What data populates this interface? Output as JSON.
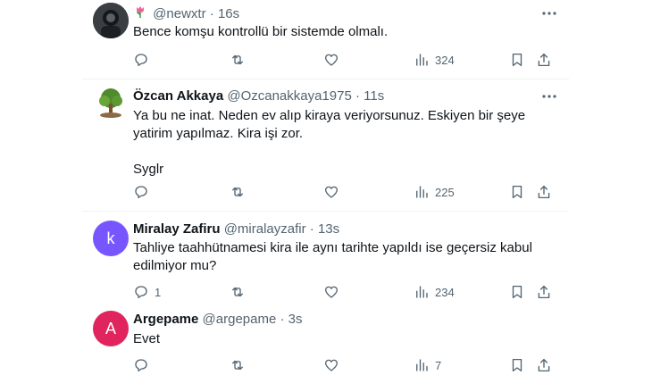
{
  "tweets": [
    {
      "name": "",
      "handle": "@newxtr",
      "sep": "·",
      "time": "16s",
      "text": "Bence komşu kontrollü bir sistemde olmalı.",
      "reply_count": "",
      "views": "324"
    },
    {
      "name": "Özcan Akkaya",
      "handle": "@Ozcanakkaya1975",
      "sep": "·",
      "time": "11s",
      "text": "Ya bu ne inat. Neden ev alıp kiraya veriyorsunuz. Eskiyen bir şeye yatirim yapılmaz. Kira işi zor.\n\nSyglr",
      "reply_count": "",
      "views": "225"
    },
    {
      "name": "Miralay Zafiru",
      "handle": "@miralayzafir",
      "sep": "·",
      "time": "13s",
      "avatar_letter": "k",
      "avatar_color": "#7856ff",
      "text": "Tahliye taahhütnamesi kira ile aynı tarihte yapıldı ise geçersiz kabul edilmiyor mu?",
      "reply_count": "1",
      "views": "234"
    },
    {
      "name": "Argepame",
      "handle": "@argepame",
      "sep": "·",
      "time": "3s",
      "avatar_letter": "A",
      "avatar_color": "#e0245e",
      "text": "Evet",
      "reply_count": "",
      "views": "7"
    }
  ]
}
